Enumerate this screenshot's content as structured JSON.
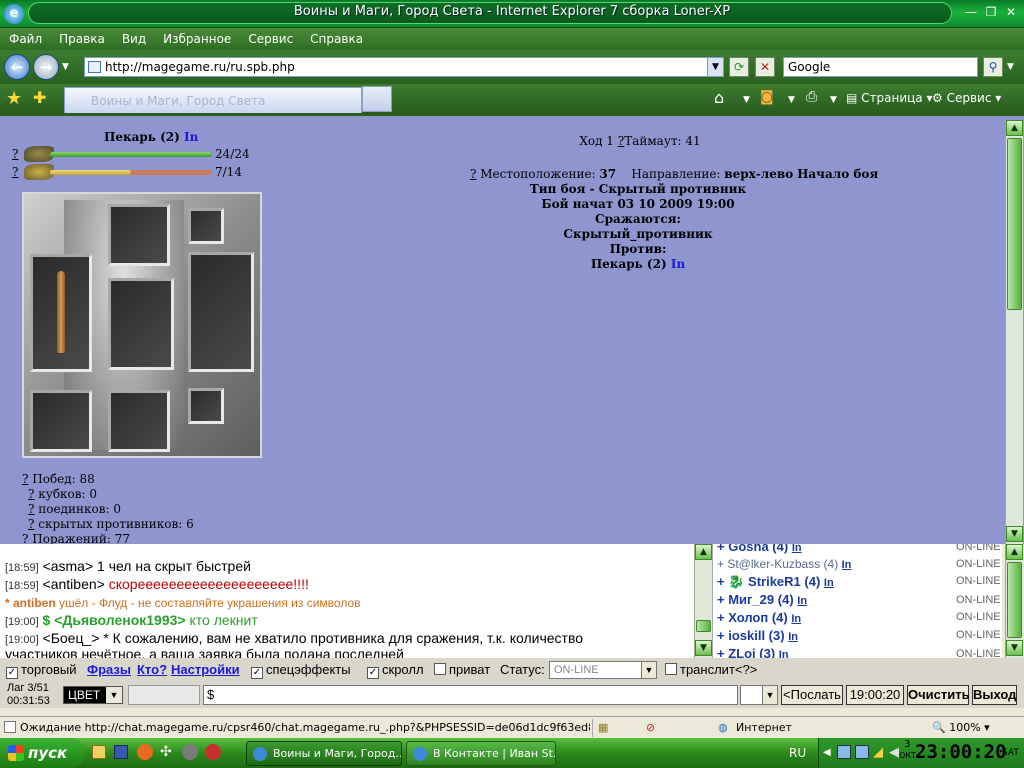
{
  "window": {
    "title": "Воины и Маги, Город Света - Internet Explorer 7 сборка Loner-XP"
  },
  "menu": [
    "Файл",
    "Правка",
    "Вид",
    "Избранное",
    "Сервис",
    "Справка"
  ],
  "address": {
    "url": "http://magegame.ru/ru.spb.php",
    "search_placeholder": "Google"
  },
  "toolbar": {
    "page": "Страница",
    "service": "Сервис"
  },
  "tab": {
    "label": "Воины и Маги, Город Света"
  },
  "player": {
    "name": "Пекарь (2)",
    "status": "In",
    "hp": "24/24",
    "hp_fraction": 1.0,
    "mana": "7/14",
    "mana_fraction": 0.5,
    "q": "?"
  },
  "battle": {
    "turn": "Ход 1",
    "timeout": "Таймаут: 41",
    "location_label": "Местоположение:",
    "location": "37",
    "direction_label": "Направление:",
    "direction": "верх-лево",
    "start": "Начало боя",
    "type": "Тип боя - Скрытый противник",
    "started": "Бой начат 03 10 2009 19:00",
    "fighting": "Сражаются:",
    "side1": "Скрытый_противник",
    "against": "Против:",
    "side2_name": "Пекарь (2)",
    "side2_status": "In"
  },
  "stats": {
    "wins": "Побед: 88",
    "cups": "кубков: 0",
    "duels": "поединков: 0",
    "hidden": "скрытых противников: 6",
    "losses": "Поражений: 77"
  },
  "chat": [
    {
      "time": "[18:59]",
      "nick": "<asma>",
      "text": " 1 чел на скрыт быстрей",
      "color": "#000000"
    },
    {
      "time": "[18:59]",
      "nick": "<antiben>",
      "text": " скорееееееееееееееееееее!!!!",
      "color": "#c00000"
    },
    {
      "time": "",
      "nick": "* antiben",
      "text": " ушёл - Флуд - не составляйте украшения из символов",
      "color": "#d07020"
    },
    {
      "time": "[19:00]",
      "nick": "$ <Дьяволенок1993>",
      "text": " кто лекнит",
      "color": "#2aa02a"
    },
    {
      "time": "[19:00]",
      "nick": "<Боец_>",
      "text": " * К сожалению, вам не хватило противника для сражения, т.к. количество",
      "color": "#000000"
    },
    {
      "time": "",
      "nick": "",
      "text": "участников нечётное, а ваша заявка была подана последней",
      "color": "#000000"
    }
  ],
  "users": [
    {
      "name": "Gosha (4)",
      "status": "ON-LINE"
    },
    {
      "name": "St@lker-Kuzbass (4)",
      "status": "ON-LINE"
    },
    {
      "name": "StrikeR1 (4)",
      "status": "ON-LINE"
    },
    {
      "name": "Миг_29 (4)",
      "status": "ON-LINE"
    },
    {
      "name": "Холоп (4)",
      "status": "ON-LINE"
    },
    {
      "name": "ioskill (3)",
      "status": "ON-LINE"
    },
    {
      "name": "ZLoi (3)",
      "status": "ON-LINE"
    }
  ],
  "controls": {
    "trade": "торговый",
    "phrases": "Фразы",
    "who": "Кто?",
    "settings": "Настройки",
    "effects": "спецэффекты",
    "scroll": "скролл",
    "private": "приват",
    "status_label": "Статус:",
    "status_value": "ON-LINE",
    "translit": "транслит",
    "translit_q": "<?>",
    "lag": "Лаг 3/51",
    "uptime": "00:31:53",
    "color": "ЦВЕТ",
    "input": "$",
    "send": "<Послать",
    "time": "19:00:20",
    "clear": "Очистить",
    "exit": "Выход"
  },
  "statusbar": {
    "text": "Ожидание http://chat.magegame.ru/cpsr460/chat.magegame.ru_.php?&PHPSESSID=de06d1dc9f63ed8e456964",
    "zone": "Интернет",
    "zoom": "100%"
  },
  "taskbar": {
    "start": "пуск",
    "tasks": [
      "Воины и Маги, Город...",
      "В Контакте | Иван St..."
    ],
    "lang": "RU",
    "date_day": "3",
    "date_month": "ОКТ",
    "clock": "23:00:20",
    "weekday": "SAT"
  }
}
